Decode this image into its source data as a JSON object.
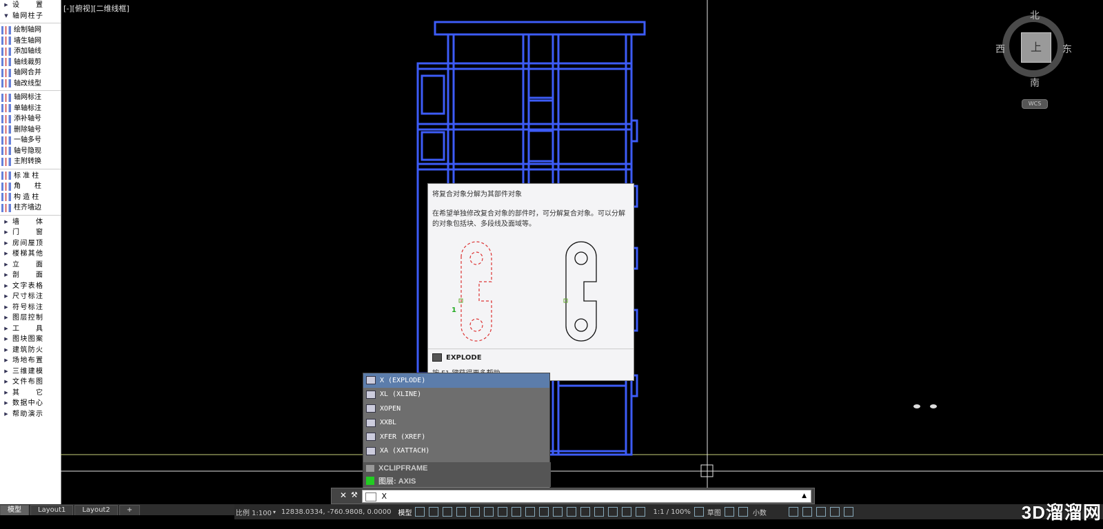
{
  "sidebar": {
    "items": [
      {
        "label": "设　　置",
        "type": "category"
      },
      {
        "label": "轴网柱子",
        "type": "category-open"
      },
      {
        "label": "绘制轴网",
        "type": "tool"
      },
      {
        "label": "墙生轴网",
        "type": "tool"
      },
      {
        "label": "添加轴线",
        "type": "tool"
      },
      {
        "label": "轴线裁剪",
        "type": "tool"
      },
      {
        "label": "轴网合并",
        "type": "tool"
      },
      {
        "label": "轴改线型",
        "type": "tool"
      },
      {
        "label": "轴网标注",
        "type": "tool"
      },
      {
        "label": "单轴标注",
        "type": "tool"
      },
      {
        "label": "添补轴号",
        "type": "tool"
      },
      {
        "label": "删除轴号",
        "type": "tool"
      },
      {
        "label": "一轴多号",
        "type": "tool"
      },
      {
        "label": "轴号隐现",
        "type": "tool"
      },
      {
        "label": "主附转换",
        "type": "tool"
      },
      {
        "label": "标 准 柱",
        "type": "tool"
      },
      {
        "label": "角　　柱",
        "type": "tool"
      },
      {
        "label": "构 造 柱",
        "type": "tool"
      },
      {
        "label": "柱齐墙边",
        "type": "tool"
      },
      {
        "label": "墙　　体",
        "type": "category"
      },
      {
        "label": "门　　窗",
        "type": "category"
      },
      {
        "label": "房间屋顶",
        "type": "category"
      },
      {
        "label": "楼梯其他",
        "type": "category"
      },
      {
        "label": "立　　面",
        "type": "category"
      },
      {
        "label": "剖　　面",
        "type": "category"
      },
      {
        "label": "文字表格",
        "type": "category"
      },
      {
        "label": "尺寸标注",
        "type": "category"
      },
      {
        "label": "符号标注",
        "type": "category"
      },
      {
        "label": "图层控制",
        "type": "category"
      },
      {
        "label": "工　　具",
        "type": "category"
      },
      {
        "label": "图块图案",
        "type": "category"
      },
      {
        "label": "建筑防火",
        "type": "category"
      },
      {
        "label": "场地布置",
        "type": "category"
      },
      {
        "label": "三维建模",
        "type": "category"
      },
      {
        "label": "文件布图",
        "type": "category"
      },
      {
        "label": "其　　它",
        "type": "category"
      },
      {
        "label": "数据中心",
        "type": "category"
      },
      {
        "label": "帮助演示",
        "type": "category"
      }
    ]
  },
  "viewport": {
    "label": "[-][俯视][二维线框]"
  },
  "viewcube": {
    "north": "北",
    "south": "南",
    "east": "东",
    "west": "西",
    "top": "上",
    "wcs": "WCS"
  },
  "tooltip": {
    "title": "将复合对象分解为其部件对象",
    "description": "在希望单独修改复合对象的部件时，可分解复合对象。可以分解的对象包括块、多段线及面域等。",
    "marker": "1",
    "command": "EXPLODE",
    "help": "按 F1 键获得更多帮助"
  },
  "autocomplete": {
    "items": [
      {
        "label": "X (EXPLODE)",
        "selected": true
      },
      {
        "label": "XL (XLINE)",
        "selected": false
      },
      {
        "label": "XOPEN",
        "selected": false
      },
      {
        "label": "XXBL",
        "selected": false
      },
      {
        "label": "XFER (XREF)",
        "selected": false
      },
      {
        "label": "XA (XATTACH)",
        "selected": false
      }
    ],
    "footer1": "XCLIPFRAME",
    "footer2": "图层: AXIS"
  },
  "commandline": {
    "value": "X"
  },
  "tabs": [
    {
      "label": "模型",
      "active": true
    },
    {
      "label": "Layout1",
      "active": false
    },
    {
      "label": "Layout2",
      "active": false
    },
    {
      "label": "+",
      "active": false
    }
  ],
  "status": {
    "scale": "比例 1:100",
    "coords": "12838.0334, -760.9808, 0.0000",
    "model": "模型",
    "annoscale": "1:1 / 100%",
    "workspace": "草图",
    "units": "小数"
  },
  "watermark": "3D溜溜网"
}
